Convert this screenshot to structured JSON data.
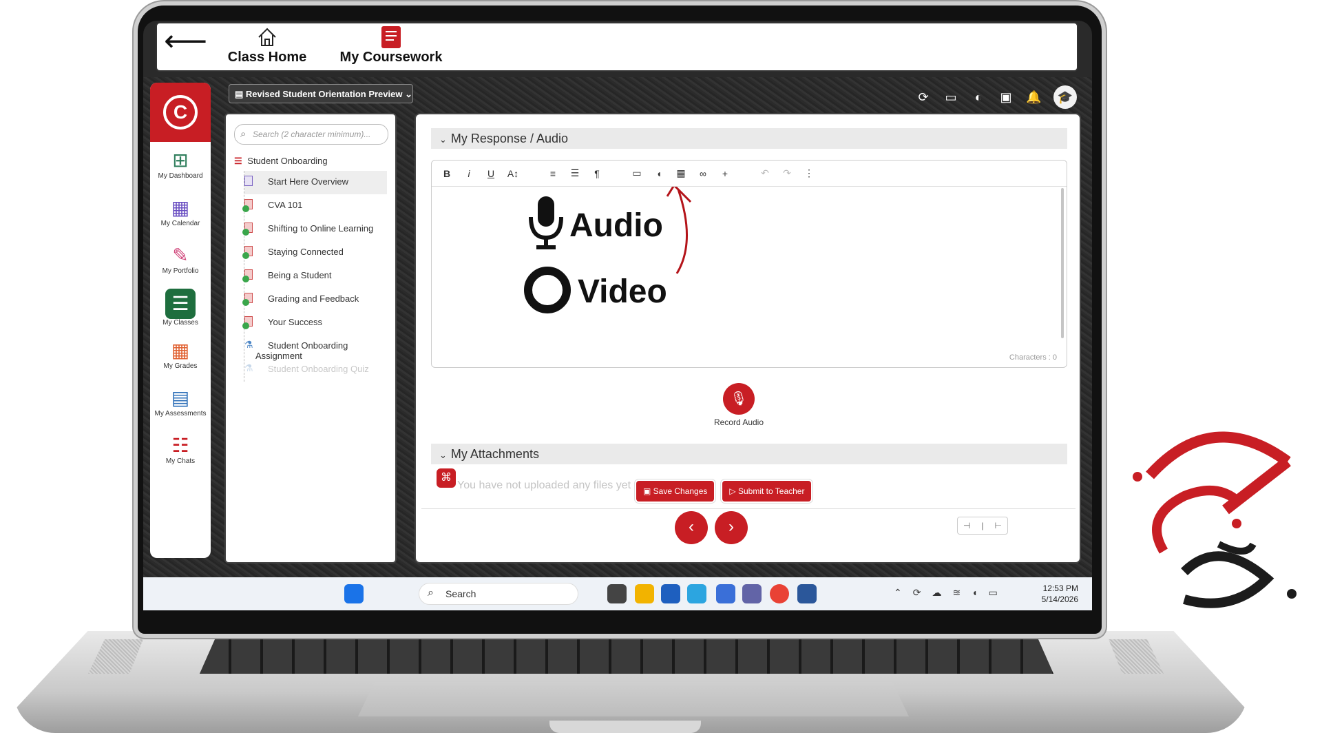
{
  "topbar": {
    "back_arrow": "⟵",
    "nav": [
      {
        "label": "Class Home",
        "icon": "house-icon"
      },
      {
        "label": "My Coursework",
        "icon": "coursework-icon"
      }
    ]
  },
  "course_select": "Revised Student Orientation Preview",
  "top_icons": {
    "refresh": "⟳",
    "window": "▭",
    "contrast": "◐",
    "chat": "▣",
    "bell": "🔔",
    "avatar": "🎓"
  },
  "rail": {
    "logo_letter": "C",
    "items": [
      {
        "label": "My Dashboard",
        "icon": "⊞"
      },
      {
        "label": "My Calendar",
        "icon": "▦"
      },
      {
        "label": "My Portfolio",
        "icon": "✎"
      },
      {
        "label": "My Classes",
        "icon": "☰"
      },
      {
        "label": "My Grades",
        "icon": "▦"
      },
      {
        "label": "My Assessments",
        "icon": "▤"
      },
      {
        "label": "My Chats",
        "icon": "☷"
      }
    ]
  },
  "tree": {
    "search_placeholder": "Search (2 character minimum)...",
    "root": "Student Onboarding",
    "items": [
      "Start Here Overview",
      "CVA 101",
      "Shifting to Online Learning",
      "Staying Connected",
      "Being a Student",
      "Grading and Feedback",
      "Your Success",
      "Student Onboarding Assignment",
      "Student Onboarding Quiz"
    ]
  },
  "main": {
    "response_header": "My Response / Audio",
    "audio_label": "Audio",
    "video_label": "Video",
    "characters": "Characters : 0",
    "record_label": "Record Audio",
    "attachments_header": "My Attachments",
    "no_files": "You have not uploaded any files yet",
    "save_label": "Save Changes",
    "submit_label": "Submit to Teacher"
  },
  "taskbar": {
    "search": "Search",
    "time": "12:53 PM",
    "date": "5/14/2026"
  },
  "colors": {
    "brand_red": "#c81e24",
    "active_green": "#1e6e3e"
  }
}
